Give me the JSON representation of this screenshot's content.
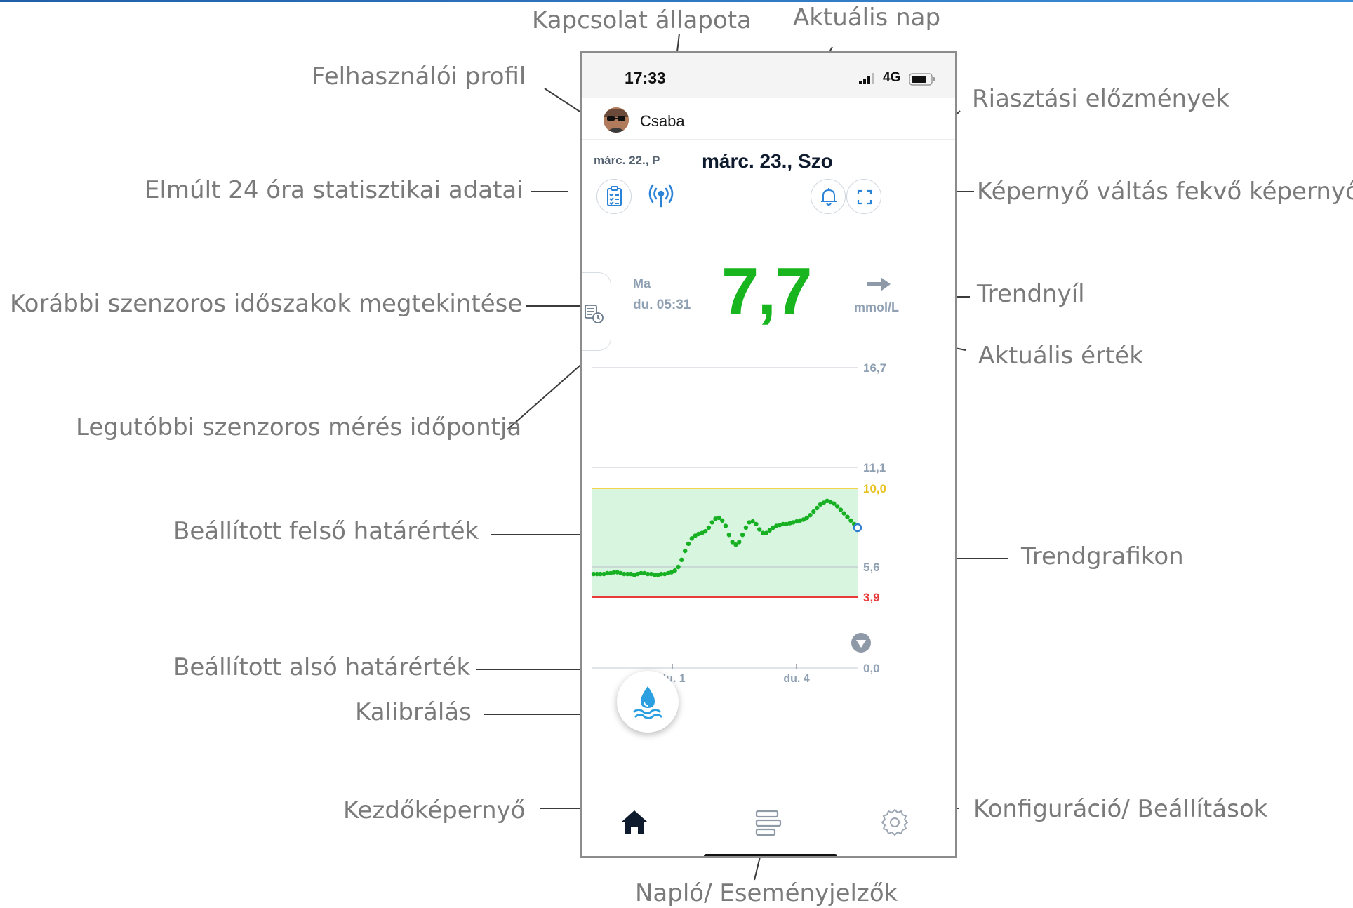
{
  "annotations": {
    "connection_status": "Kapcsolat állapota",
    "current_day": "Aktuális nap",
    "user_profile": "Felhasználói profil",
    "alarm_history": "Riasztási előzmények",
    "stats_24h": "Elmúlt 24 óra statisztikai adatai",
    "landscape_switch": "Képernyő váltás fekvő képernyőre",
    "previous_sensor_periods": "Korábbi szenzoros időszakok megtekintése",
    "trend_arrow": "Trendnyíl",
    "current_value": "Aktuális érték",
    "last_measurement_time": "Legutóbbi szenzoros mérés időpontja",
    "upper_limit": "Beállított felső határérték",
    "trend_graph": "Trendgrafikon",
    "lower_limit": "Beállított alsó határérték",
    "calibration": "Kalibrálás",
    "home_screen": "Kezdőképernyő",
    "settings": "Konfiguráció/ Beállítások",
    "log": "Napló/ Eseményjelzők"
  },
  "phone": {
    "status_bar": {
      "time": "17:33",
      "network": "4G"
    },
    "user": {
      "name": "Csaba"
    },
    "previous_day": "márc. 22., P",
    "current_day": "márc. 23., Szo",
    "reading": {
      "day_label": "Ma",
      "time_label": "du. 05:31",
      "value": "7,7",
      "unit": "mmol/L",
      "trend": "steady (right arrow)"
    }
  },
  "chart_data": {
    "type": "scatter",
    "y_tick_labels": [
      "16,7",
      "11,1",
      "10,0",
      "5,6",
      "3,9",
      "0,0"
    ],
    "x_tick_labels": [
      "du. 1",
      "du. 4"
    ],
    "target_range": {
      "low": 3.9,
      "high": 10.0
    },
    "ylim": [
      0,
      16.7
    ],
    "colors": {
      "points": "#17b023",
      "target_fill": "#d7f5df",
      "upper_line": "#f5d54a",
      "lower_line": "#e83a3a",
      "last_point": "#2f7fd1"
    },
    "series": [
      {
        "values": [
          5.2,
          5.2,
          5.2,
          5.2,
          5.25,
          5.25,
          5.3,
          5.3,
          5.25,
          5.2,
          5.2,
          5.2,
          5.15,
          5.2,
          5.25,
          5.25,
          5.2,
          5.2,
          5.15,
          5.15,
          5.2,
          5.2,
          5.25,
          5.3,
          5.4,
          5.6,
          6.0,
          6.5,
          6.9,
          7.2,
          7.35,
          7.45,
          7.5,
          7.6,
          7.8,
          8.1,
          8.3,
          8.35,
          8.2,
          7.9,
          7.4,
          7.0,
          6.85,
          7.0,
          7.4,
          7.8,
          8.1,
          8.15,
          8.0,
          7.7,
          7.5,
          7.5,
          7.65,
          7.8,
          7.9,
          7.95,
          8.0,
          8.0,
          8.05,
          8.1,
          8.15,
          8.2,
          8.25,
          8.35,
          8.5,
          8.7,
          8.9,
          9.1,
          9.2,
          9.3,
          9.25,
          9.15,
          9.0,
          8.8,
          8.6,
          8.4,
          8.2,
          8.0,
          7.8
        ]
      }
    ]
  },
  "icons": {
    "stats": "clipboard-checklist-icon",
    "connection": "antenna-icon",
    "alarm": "bell-icon",
    "landscape": "expand-icon",
    "history": "history-document-icon",
    "calibration": "blood-drop-icon",
    "home": "home-icon",
    "log": "log-icon",
    "settings": "gear-icon"
  }
}
